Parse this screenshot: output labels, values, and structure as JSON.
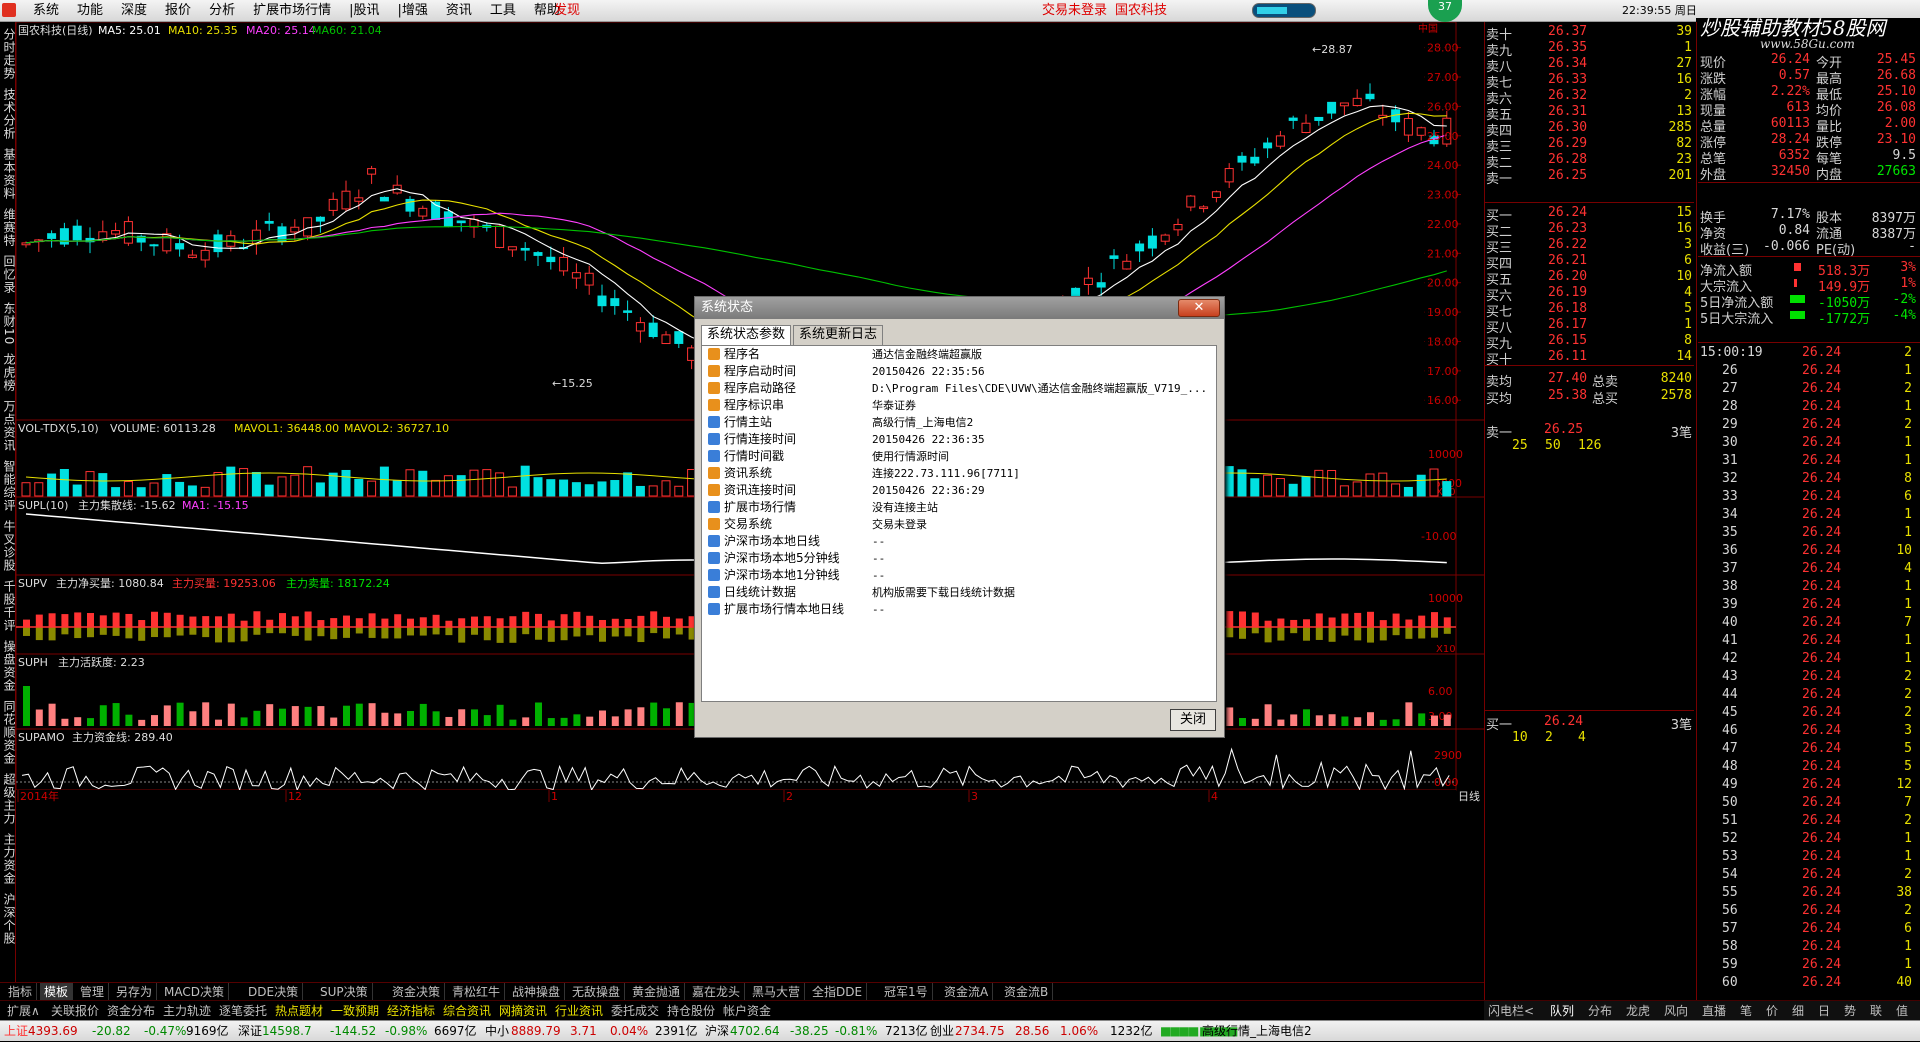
{
  "menubar": {
    "items": [
      "系统",
      "功能",
      "深度",
      "报价",
      "分析",
      "扩展市场行情",
      "|股讯",
      "|增强",
      "资讯",
      "工具",
      "帮助"
    ],
    "discover": "发现",
    "trade_status": "交易未登录",
    "stock_name": "国农科技",
    "badge": "37",
    "clock": "22:39:55 周日"
  },
  "brand": {
    "title": "炒股辅助教材58股网",
    "url": "www.58Gu.com"
  },
  "left_tabs": [
    "分时走势",
    "技术分析",
    "基本资料",
    "维赛特",
    "回忆录",
    "东财10",
    "龙虎榜",
    "万点资讯",
    "智能综评",
    "牛叉诊股",
    "千股千评",
    "操盘资金",
    "同花顺资金",
    "超级主力",
    "主力资金",
    "沪深个股"
  ],
  "main_chart": {
    "title": "国农科技(日线)",
    "ma5": "MA5: 25.01",
    "ma10": "MA10: 25.35",
    "ma20": "MA20: 25.14",
    "ma60": "MA60: 21.04",
    "high_label": "28.87",
    "low_label": "15.25",
    "y_ticks": [
      "28.00",
      "27.00",
      "26.00",
      "25.00",
      "24.00",
      "23.00",
      "22.00",
      "21.00",
      "20.00",
      "19.00",
      "18.00",
      "17.00",
      "16.00"
    ],
    "corner": "中国"
  },
  "vol_panel": {
    "title": "VOL-TDX(5,10)",
    "volume": "VOLUME: 60113.28",
    "mavol1": "MAVOL1: 36448.00",
    "mavol2": "MAVOL2: 36727.10",
    "y_ticks": [
      "10000",
      "5000"
    ],
    "unit": "X10"
  },
  "supl_panel": {
    "title": "SUPL(10)",
    "label": "主力集散线: -15.62",
    "ma1": "MA1: -15.15",
    "y_ticks": [
      "-10.00"
    ]
  },
  "supv_panel": {
    "title": "SUPV",
    "net": "主力净买量: 1080.84",
    "buy": "主力买量: 19253.06",
    "sell": "主力卖量: 18172.24",
    "y_ticks": [
      "10000",
      "0"
    ],
    "unit": "X10"
  },
  "suph_panel": {
    "title": "SUPH",
    "label": "主力活跃度: 2.23",
    "y_ticks": [
      "6.00",
      "3.00"
    ]
  },
  "supamo_panel": {
    "title": "SUPAMO",
    "label": "主力资金线: 289.40",
    "y_ticks": [
      "2900",
      "0.00"
    ]
  },
  "x_axis": {
    "labels": [
      "2014年",
      "12",
      "1",
      "2",
      "3",
      "4"
    ],
    "period": "日线"
  },
  "order_book": {
    "sell": [
      {
        "label": "卖十",
        "price": "26.37",
        "vol": "39"
      },
      {
        "label": "卖九",
        "price": "26.35",
        "vol": "1"
      },
      {
        "label": "卖八",
        "price": "26.34",
        "vol": "27"
      },
      {
        "label": "卖七",
        "price": "26.33",
        "vol": "16"
      },
      {
        "label": "卖六",
        "price": "26.32",
        "vol": "2"
      },
      {
        "label": "卖五",
        "price": "26.31",
        "vol": "13"
      },
      {
        "label": "卖四",
        "price": "26.30",
        "vol": "285"
      },
      {
        "label": "卖三",
        "price": "26.29",
        "vol": "82"
      },
      {
        "label": "卖二",
        "price": "26.28",
        "vol": "23"
      },
      {
        "label": "卖一",
        "price": "26.25",
        "vol": "201"
      }
    ],
    "buy": [
      {
        "label": "买一",
        "price": "26.24",
        "vol": "15"
      },
      {
        "label": "买二",
        "price": "26.23",
        "vol": "16"
      },
      {
        "label": "买三",
        "price": "26.22",
        "vol": "3"
      },
      {
        "label": "买四",
        "price": "26.21",
        "vol": "6"
      },
      {
        "label": "买五",
        "price": "26.20",
        "vol": "10"
      },
      {
        "label": "买六",
        "price": "26.19",
        "vol": "4"
      },
      {
        "label": "买七",
        "price": "26.18",
        "vol": "5"
      },
      {
        "label": "买八",
        "price": "26.17",
        "vol": "1"
      },
      {
        "label": "买九",
        "price": "26.15",
        "vol": "8"
      },
      {
        "label": "买十",
        "price": "26.11",
        "vol": "14"
      }
    ],
    "avg_sell": {
      "label": "卖均",
      "price": "27.40",
      "total_label": "总卖",
      "total": "8240"
    },
    "avg_buy": {
      "label": "买均",
      "price": "25.38",
      "total_label": "总买",
      "total": "2578"
    },
    "sell1_detail": {
      "label": "卖一",
      "price": "26.25",
      "count": "3笔",
      "qty": [
        "25",
        "50",
        "126"
      ]
    },
    "buy1_detail": {
      "label": "买一",
      "price": "26.24",
      "count": "3笔",
      "qty": [
        "10",
        "2",
        "4"
      ]
    }
  },
  "quote_stats": [
    {
      "k1": "现价",
      "v1": "26.24",
      "k2": "今开",
      "v2": "25.45"
    },
    {
      "k1": "涨跌",
      "v1": "0.57",
      "k2": "最高",
      "v2": "26.68"
    },
    {
      "k1": "涨幅",
      "v1": "2.22%",
      "k2": "最低",
      "v2": "25.10"
    },
    {
      "k1": "现量",
      "v1": "613",
      "k2": "均价",
      "v2": "26.08"
    },
    {
      "k1": "总量",
      "v1": "60113",
      "k2": "量比",
      "v2": "2.00"
    },
    {
      "k1": "涨停",
      "v1": "28.24",
      "k2": "跌停",
      "v2": "23.10"
    },
    {
      "k1": "总笔",
      "v1": "6352",
      "k2": "每笔",
      "v2": "9.5"
    },
    {
      "k1": "外盘",
      "v1": "32450",
      "k2": "内盘",
      "v2": "27663"
    }
  ],
  "quote_stats2": [
    {
      "k1": "换手",
      "v1": "7.17%",
      "k2": "股本",
      "v2": "8397万"
    },
    {
      "k1": "净资",
      "v1": "0.84",
      "k2": "流通",
      "v2": "8387万"
    },
    {
      "k1": "收益(三)",
      "v1": "-0.066",
      "k2": "PE(动)",
      "v2": "-"
    }
  ],
  "flows": [
    {
      "label": "净流入额",
      "value": "518.3万",
      "pct": "3%",
      "dir": "up"
    },
    {
      "label": "大宗流入",
      "value": "149.9万",
      "pct": "1%",
      "dir": "up"
    },
    {
      "label": "5日净流入额",
      "value": "-1050万",
      "pct": "-2%",
      "dir": "dn"
    },
    {
      "label": "5日大宗流入",
      "value": "-1772万",
      "pct": "-4%",
      "dir": "dn"
    }
  ],
  "ticks": {
    "first_time": "15:00:19",
    "rows": [
      {
        "t": "",
        "p": "26.24",
        "v": "2"
      },
      {
        "t": "26",
        "p": "26.24",
        "v": "1"
      },
      {
        "t": "27",
        "p": "26.24",
        "v": "2"
      },
      {
        "t": "28",
        "p": "26.24",
        "v": "1"
      },
      {
        "t": "29",
        "p": "26.24",
        "v": "2"
      },
      {
        "t": "30",
        "p": "26.24",
        "v": "1"
      },
      {
        "t": "31",
        "p": "26.24",
        "v": "1"
      },
      {
        "t": "32",
        "p": "26.24",
        "v": "8"
      },
      {
        "t": "33",
        "p": "26.24",
        "v": "6"
      },
      {
        "t": "34",
        "p": "26.24",
        "v": "1"
      },
      {
        "t": "35",
        "p": "26.24",
        "v": "1"
      },
      {
        "t": "36",
        "p": "26.24",
        "v": "10"
      },
      {
        "t": "37",
        "p": "26.24",
        "v": "4"
      },
      {
        "t": "38",
        "p": "26.24",
        "v": "1"
      },
      {
        "t": "39",
        "p": "26.24",
        "v": "1"
      },
      {
        "t": "40",
        "p": "26.24",
        "v": "7"
      },
      {
        "t": "41",
        "p": "26.24",
        "v": "1"
      },
      {
        "t": "42",
        "p": "26.24",
        "v": "1"
      },
      {
        "t": "43",
        "p": "26.24",
        "v": "2"
      },
      {
        "t": "44",
        "p": "26.24",
        "v": "2"
      },
      {
        "t": "45",
        "p": "26.24",
        "v": "2"
      },
      {
        "t": "46",
        "p": "26.24",
        "v": "3"
      },
      {
        "t": "47",
        "p": "26.24",
        "v": "5"
      },
      {
        "t": "48",
        "p": "26.24",
        "v": "5"
      },
      {
        "t": "49",
        "p": "26.24",
        "v": "12"
      },
      {
        "t": "50",
        "p": "26.24",
        "v": "7"
      },
      {
        "t": "51",
        "p": "26.24",
        "v": "2"
      },
      {
        "t": "52",
        "p": "26.24",
        "v": "1"
      },
      {
        "t": "53",
        "p": "26.24",
        "v": "1"
      },
      {
        "t": "54",
        "p": "26.24",
        "v": "2"
      },
      {
        "t": "55",
        "p": "26.24",
        "v": "38"
      },
      {
        "t": "56",
        "p": "26.24",
        "v": "2"
      },
      {
        "t": "57",
        "p": "26.24",
        "v": "6"
      },
      {
        "t": "58",
        "p": "26.24",
        "v": "1"
      },
      {
        "t": "59",
        "p": "26.24",
        "v": "1"
      },
      {
        "t": "60",
        "p": "26.24",
        "v": "40"
      }
    ]
  },
  "bottom_tabs1": [
    "指标",
    "模板",
    "管理",
    "另存为",
    "MACD决策",
    "DDE决策",
    "SUP决策",
    "资金决策",
    "青松红牛",
    "战神操盘",
    "无敌操盘",
    "黄金抛通",
    "嘉在龙头",
    "黑马大营",
    "全指DDE",
    "冠军1号",
    "资金流A",
    "资金流B"
  ],
  "bottom_tabs2": [
    "扩展∧",
    "关联报价",
    "资金分布",
    "主力轨迹",
    "逐笔委托",
    "热点题材",
    "一致预期",
    "经济指标",
    "综合资讯",
    "网摘资讯",
    "行业资讯",
    "委托成交",
    "持仓股份",
    "帐户资金"
  ],
  "right_tabs": [
    "闪电栏<",
    "队列",
    "分布",
    "龙虎",
    "风向",
    "直播",
    "笔",
    "价",
    "细",
    "日",
    "势",
    "联",
    "值"
  ],
  "statusbar": {
    "sh_label": "上证",
    "sh_val": "4393.69",
    "sh_chg": "-20.82",
    "sh_pct": "-0.47%",
    "sh_amt": "9169亿",
    "sz_label": "深证",
    "sz_val": "14598.7",
    "sz_chg": "-144.52",
    "sz_pct": "-0.98%",
    "sz_amt": "6697亿",
    "zx_label": "中小",
    "zx_val": "8889.79",
    "zx_chg": "3.71",
    "zx_pct": "0.04%",
    "zx_amt": "2391亿",
    "hs_label": "沪深",
    "hs_val": "4702.64",
    "hs_chg": "-38.25",
    "hs_pct": "-0.81%",
    "hs_amt": "7213亿",
    "cy_label": "创业",
    "cy_val": "2734.75",
    "cy_chg": "28.56",
    "cy_pct": "1.06%",
    "cy_amt": "1232亿",
    "server": "高级行情_上海电信2"
  },
  "dialog": {
    "title": "系统状态",
    "close_x": "✕",
    "tabs": [
      "系统状态参数",
      "系统更新日志"
    ],
    "rows": [
      {
        "k": "程序名",
        "v": "通达信金融终端超赢版",
        "ic": "o"
      },
      {
        "k": "程序启动时间",
        "v": "20150426 22:35:56",
        "ic": "o"
      },
      {
        "k": "程序启动路径",
        "v": "D:\\Program Files\\CDE\\UVW\\通达信金融终端超赢版_V719_...",
        "ic": "o"
      },
      {
        "k": "程序标识串",
        "v": "华泰证券",
        "ic": "o"
      },
      {
        "k": "行情主站",
        "v": "高级行情_上海电信2",
        "ic": "b"
      },
      {
        "k": "行情连接时间",
        "v": "20150426 22:36:35",
        "ic": "b"
      },
      {
        "k": "行情时间戳",
        "v": "使用行情源时间",
        "ic": "b"
      },
      {
        "k": "资讯系统",
        "v": "连接222.73.111.96[7711]",
        "ic": "o"
      },
      {
        "k": "资讯连接时间",
        "v": "20150426 22:36:29",
        "ic": "o"
      },
      {
        "k": "扩展市场行情",
        "v": "没有连接主站",
        "ic": "b"
      },
      {
        "k": "交易系统",
        "v": "交易未登录",
        "ic": "o"
      },
      {
        "k": "沪深市场本地日线",
        "v": "--",
        "ic": "b"
      },
      {
        "k": "沪深市场本地5分钟线",
        "v": "--",
        "ic": "b"
      },
      {
        "k": "沪深市场本地1分钟线",
        "v": "--",
        "ic": "b"
      },
      {
        "k": "日线统计数据",
        "v": "机构版需要下载日线统计数据",
        "ic": "b"
      },
      {
        "k": "扩展市场行情本地日线",
        "v": "--",
        "ic": "b"
      }
    ],
    "close_button": "关闭"
  },
  "colors": {
    "up": "#ff3232",
    "down": "#00e0e0",
    "ma5": "#ffffff",
    "ma10": "#e8e000",
    "ma20": "#ff40ff",
    "ma60": "#00c000",
    "grid": "#7a0000"
  }
}
